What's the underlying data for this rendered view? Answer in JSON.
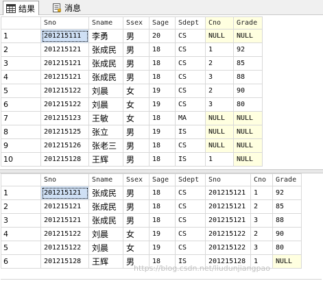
{
  "tabs": [
    {
      "label": "结果",
      "icon": "grid-icon",
      "active": true
    },
    {
      "label": "消息",
      "icon": "message-icon",
      "active": false
    }
  ],
  "result1": {
    "columns": [
      "Sno",
      "Sname",
      "Ssex",
      "Sage",
      "Sdept",
      "Cno",
      "Grade"
    ],
    "rows": [
      [
        "201215111",
        "李勇",
        "男",
        "20",
        "CS",
        "NULL",
        "NULL"
      ],
      [
        "201215121",
        "张成民",
        "男",
        "18",
        "CS",
        "1",
        "92"
      ],
      [
        "201215121",
        "张成民",
        "男",
        "18",
        "CS",
        "2",
        "85"
      ],
      [
        "201215121",
        "张成民",
        "男",
        "18",
        "CS",
        "3",
        "88"
      ],
      [
        "201215122",
        "刘晨",
        "女",
        "19",
        "CS",
        "2",
        "90"
      ],
      [
        "201215122",
        "刘晨",
        "女",
        "19",
        "CS",
        "3",
        "80"
      ],
      [
        "201215123",
        "王敏",
        "女",
        "18",
        "MA",
        "NULL",
        "NULL"
      ],
      [
        "201215125",
        "张立",
        "男",
        "19",
        "IS",
        "NULL",
        "NULL"
      ],
      [
        "201215126",
        "张老三",
        "男",
        "18",
        "CS",
        "NULL",
        "NULL"
      ],
      [
        "201215128",
        "王辉",
        "男",
        "18",
        "IS",
        "1",
        "NULL"
      ]
    ]
  },
  "result2": {
    "columns": [
      "Sno",
      "Sname",
      "Ssex",
      "Sage",
      "Sdept",
      "Sno",
      "Cno",
      "Grade"
    ],
    "rows": [
      [
        "201215121",
        "张成民",
        "男",
        "18",
        "CS",
        "201215121",
        "1",
        "92"
      ],
      [
        "201215121",
        "张成民",
        "男",
        "18",
        "CS",
        "201215121",
        "2",
        "85"
      ],
      [
        "201215121",
        "张成民",
        "男",
        "18",
        "CS",
        "201215121",
        "3",
        "88"
      ],
      [
        "201215122",
        "刘晨",
        "女",
        "19",
        "CS",
        "201215122",
        "2",
        "90"
      ],
      [
        "201215122",
        "刘晨",
        "女",
        "19",
        "CS",
        "201215122",
        "3",
        "80"
      ],
      [
        "201215128",
        "王辉",
        "男",
        "18",
        "IS",
        "201215128",
        "1",
        "NULL"
      ]
    ]
  },
  "watermark": "https://blog.csdn.net/liudunjiangpao",
  "colors": {
    "null_bg": "#ffffe0",
    "selected_bg": "#cfe0f5",
    "grid_line": "#d8d8d8"
  }
}
